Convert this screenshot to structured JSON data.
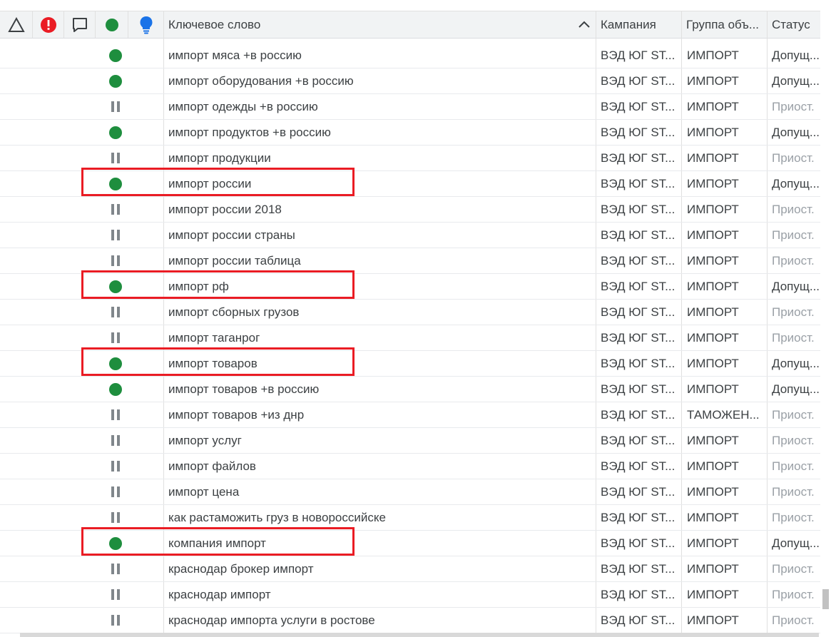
{
  "header": {
    "icons": {
      "warning": "triangle-outline-icon",
      "error": "error-icon",
      "comment": "comment-icon",
      "status": "status-dot-icon",
      "idea": "lightbulb-icon"
    },
    "keyword": "Ключевое слово",
    "campaign": "Кампания",
    "ad_group": "Группа объ...",
    "status": "Статус",
    "sort_icon": "chevron-up-icon"
  },
  "colors": {
    "active_dot": "#1e8e3e",
    "error_red": "#ea1c24",
    "bulb_blue": "#1a73e8",
    "highlight": "#ea1c24"
  },
  "rows": [
    {
      "state": "active",
      "keyword": "импорт мяса +в россию",
      "campaign": "ВЭД ЮГ ST...",
      "group": "ИМПОРТ",
      "status": "Допущ..."
    },
    {
      "state": "active",
      "keyword": "импорт оборудования +в россию",
      "campaign": "ВЭД ЮГ ST...",
      "group": "ИМПОРТ",
      "status": "Допущ..."
    },
    {
      "state": "paused",
      "keyword": "импорт одежды +в россию",
      "campaign": "ВЭД ЮГ ST...",
      "group": "ИМПОРТ",
      "status": "Приост."
    },
    {
      "state": "active",
      "keyword": "импорт продуктов +в россию",
      "campaign": "ВЭД ЮГ ST...",
      "group": "ИМПОРТ",
      "status": "Допущ..."
    },
    {
      "state": "paused",
      "keyword": "импорт продукции",
      "campaign": "ВЭД ЮГ ST...",
      "group": "ИМПОРТ",
      "status": "Приост."
    },
    {
      "state": "active",
      "keyword": "импорт россии",
      "campaign": "ВЭД ЮГ ST...",
      "group": "ИМПОРТ",
      "status": "Допущ...",
      "highlight": true
    },
    {
      "state": "paused",
      "keyword": "импорт россии 2018",
      "campaign": "ВЭД ЮГ ST...",
      "group": "ИМПОРТ",
      "status": "Приост."
    },
    {
      "state": "paused",
      "keyword": "импорт россии страны",
      "campaign": "ВЭД ЮГ ST...",
      "group": "ИМПОРТ",
      "status": "Приост."
    },
    {
      "state": "paused",
      "keyword": "импорт россии таблица",
      "campaign": "ВЭД ЮГ ST...",
      "group": "ИМПОРТ",
      "status": "Приост."
    },
    {
      "state": "active",
      "keyword": "импорт рф",
      "campaign": "ВЭД ЮГ ST...",
      "group": "ИМПОРТ",
      "status": "Допущ...",
      "highlight": true
    },
    {
      "state": "paused",
      "keyword": "импорт сборных грузов",
      "campaign": "ВЭД ЮГ ST...",
      "group": "ИМПОРТ",
      "status": "Приост."
    },
    {
      "state": "paused",
      "keyword": "импорт таганрог",
      "campaign": "ВЭД ЮГ ST...",
      "group": "ИМПОРТ",
      "status": "Приост."
    },
    {
      "state": "active",
      "keyword": "импорт товаров",
      "campaign": "ВЭД ЮГ ST...",
      "group": "ИМПОРТ",
      "status": "Допущ...",
      "highlight": true
    },
    {
      "state": "active",
      "keyword": "импорт товаров +в россию",
      "campaign": "ВЭД ЮГ ST...",
      "group": "ИМПОРТ",
      "status": "Допущ..."
    },
    {
      "state": "paused",
      "keyword": "импорт товаров +из днр",
      "campaign": "ВЭД ЮГ ST...",
      "group": "ТАМОЖЕН...",
      "status": "Приост."
    },
    {
      "state": "paused",
      "keyword": "импорт услуг",
      "campaign": "ВЭД ЮГ ST...",
      "group": "ИМПОРТ",
      "status": "Приост."
    },
    {
      "state": "paused",
      "keyword": "импорт файлов",
      "campaign": "ВЭД ЮГ ST...",
      "group": "ИМПОРТ",
      "status": "Приост."
    },
    {
      "state": "paused",
      "keyword": "импорт цена",
      "campaign": "ВЭД ЮГ ST...",
      "group": "ИМПОРТ",
      "status": "Приост."
    },
    {
      "state": "paused",
      "keyword": "как растаможить груз в новороссийске",
      "campaign": "ВЭД ЮГ ST...",
      "group": "ИМПОРТ",
      "status": "Приост."
    },
    {
      "state": "active",
      "keyword": "компания импорт",
      "campaign": "ВЭД ЮГ ST...",
      "group": "ИМПОРТ",
      "status": "Допущ...",
      "highlight": true
    },
    {
      "state": "paused",
      "keyword": "краснодар брокер импорт",
      "campaign": "ВЭД ЮГ ST...",
      "group": "ИМПОРТ",
      "status": "Приост."
    },
    {
      "state": "paused",
      "keyword": "краснодар импорт",
      "campaign": "ВЭД ЮГ ST...",
      "group": "ИМПОРТ",
      "status": "Приост."
    },
    {
      "state": "paused",
      "keyword": "краснодар импорта услуги в ростове",
      "campaign": "ВЭД ЮГ ST...",
      "group": "ИМПОРТ",
      "status": "Приост."
    }
  ]
}
